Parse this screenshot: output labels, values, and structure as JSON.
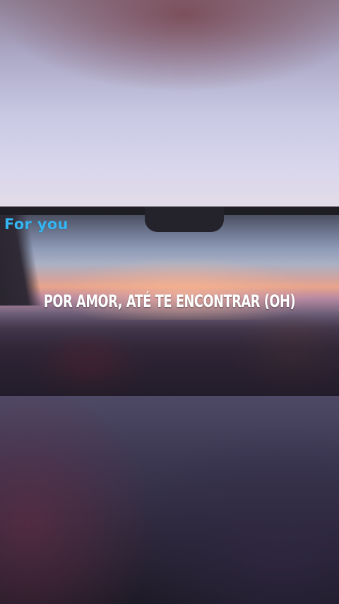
{
  "video": {
    "watermark": "For you",
    "lyric_line": "POR AMOR, ATÉ TE ENCONTRAR (OH)"
  },
  "colors": {
    "watermark": "#35b5f2",
    "lyric_text": "#ffffff",
    "background_dark": "#1f1c2a"
  }
}
